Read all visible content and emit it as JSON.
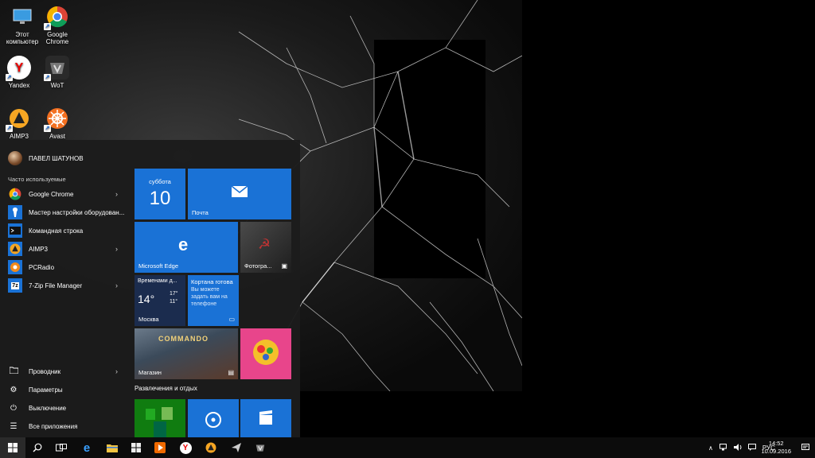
{
  "desktop": {
    "icons": [
      {
        "label": "Этот компьютер",
        "icon": "computer-icon"
      },
      {
        "label": "Google Chrome",
        "icon": "chrome-icon"
      },
      {
        "label": "Yandex",
        "icon": "yandex-icon",
        "glyph": "Y"
      },
      {
        "label": "WoT",
        "icon": "wot-icon"
      },
      {
        "label": "AIMP3",
        "icon": "aimp-icon"
      },
      {
        "label": "Avast",
        "icon": "avast-icon"
      }
    ]
  },
  "start_menu": {
    "user_name": "ПАВЕЛ ШАТУНОВ",
    "frequent_label": "Часто используемые",
    "apps": [
      {
        "label": "Google Chrome",
        "icon": "chrome-icon",
        "has_submenu": true
      },
      {
        "label": "Мастер настройки оборудован...",
        "icon": "wizard-icon",
        "has_submenu": false
      },
      {
        "label": "Командная строка",
        "icon": "cmd-icon",
        "has_submenu": false
      },
      {
        "label": "AIMP3",
        "icon": "aimp-icon",
        "has_submenu": true
      },
      {
        "label": "PCRadio",
        "icon": "pcradio-icon",
        "has_submenu": false
      },
      {
        "label": "7-Zip File Manager",
        "icon": "7zip-icon",
        "glyph": "7z",
        "has_submenu": true
      }
    ],
    "bottom": [
      {
        "label": "Проводник",
        "icon": "folder-icon",
        "has_submenu": true
      },
      {
        "label": "Параметры",
        "icon": "gear-icon"
      },
      {
        "label": "Выключение",
        "icon": "power-icon"
      },
      {
        "label": "Все приложения",
        "icon": "all-apps-icon"
      }
    ],
    "tiles": {
      "calendar": {
        "day_name": "суббота",
        "day_number": "10"
      },
      "mail": {
        "label": "Почта"
      },
      "edge": {
        "label": "Microsoft Edge",
        "glyph": "e"
      },
      "photos": {
        "label": "Фотогра..."
      },
      "weather": {
        "title": "Временами д...",
        "temp": "14°",
        "high": "17°",
        "low": "11°",
        "city": "Москва"
      },
      "cortana": {
        "title": "Кортана готова",
        "text": "Вы можете задать вам на телефоне"
      },
      "store": {
        "label": "Магазин",
        "game_title": "COMMANDO"
      },
      "candy": {
        "label": "Candy Crush"
      },
      "group_label": "Развлечения и отдых"
    }
  },
  "taskbar": {
    "items": [
      {
        "icon": "windows-start-icon"
      },
      {
        "icon": "search-icon"
      },
      {
        "icon": "task-view-icon"
      },
      {
        "icon": "edge-icon",
        "glyph": "e"
      },
      {
        "icon": "file-explorer-icon"
      },
      {
        "icon": "store-icon"
      },
      {
        "icon": "media-player-icon"
      },
      {
        "icon": "yandex-icon",
        "glyph": "Y"
      },
      {
        "icon": "aimp-icon"
      },
      {
        "icon": "arrow-icon"
      },
      {
        "icon": "wot-icon"
      }
    ],
    "tray": {
      "language": "РУС",
      "time": "14:52",
      "date": "10.09.2016"
    }
  },
  "colors": {
    "tile_blue": "#1a72d6",
    "start_bg": "#1c1c1c",
    "taskbar_bg": "#0c0c0c"
  }
}
